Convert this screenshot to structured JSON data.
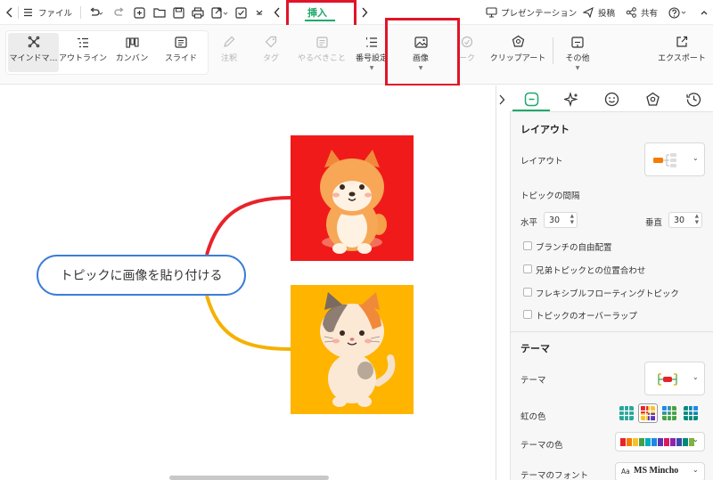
{
  "titlebar": {
    "file_label": "ファイル",
    "active_tab": "挿入",
    "presentation_label": "プレゼンテーション",
    "post_label": "投稿",
    "share_label": "共有",
    "help_icon": "question-circle-icon"
  },
  "ribbon": {
    "views": [
      {
        "label": "マインドマ…",
        "icon": "mindmap-icon"
      },
      {
        "label": "アウトライン",
        "icon": "outline-icon"
      },
      {
        "label": "カンバン",
        "icon": "kanban-icon"
      },
      {
        "label": "スライド",
        "icon": "slide-icon"
      }
    ],
    "annotation_label": "注釈",
    "tag_label": "タグ",
    "todo_label": "やるべきこと",
    "numbering_label": "番号設定",
    "image_label": "画像",
    "mark_label": "ーク",
    "clipart_label": "クリップアート",
    "more_label": "その他",
    "export_label": "エクスポート"
  },
  "canvas": {
    "topic_text": "トピックに画像を貼り付ける",
    "branch_colors": [
      "#e8232b",
      "#f5b100"
    ],
    "images": [
      {
        "name": "shiba-dog-illustration",
        "background": "#f01a1a"
      },
      {
        "name": "calico-cat-illustration",
        "background": "#ffb400"
      }
    ]
  },
  "panel": {
    "tab_icons": [
      "layout-icon",
      "sparkle-icon",
      "sticker-icon",
      "theme-icon",
      "clock-icon"
    ],
    "layout_section": "レイアウト",
    "layout_label": "レイアウト",
    "spacing_label": "トピックの間隔",
    "horizontal_label": "水平",
    "horizontal_value": "30",
    "vertical_label": "垂直",
    "vertical_value": "30",
    "options": [
      "ブランチの自由配置",
      "兄弟トピックとの位置合わせ",
      "フレキシブルフローティングトピック",
      "トピックのオーバーラップ"
    ],
    "theme_section": "テーマ",
    "theme_label": "テーマ",
    "rainbow_label": "虹の色",
    "theme_color_label": "テーマの色",
    "theme_font_label": "テーマのフォント",
    "theme_font_value": "MS Mincho",
    "theme_font_prefix": "Aa",
    "accent_color": "#1fa86a",
    "palette": [
      "#e8232b",
      "#f57c00",
      "#fbc02d",
      "#43a047",
      "#00acc1",
      "#1e88e5",
      "#5e35b1",
      "#d81b60",
      "#8e24aa",
      "#3949ab",
      "#00897b",
      "#7cb342"
    ]
  }
}
